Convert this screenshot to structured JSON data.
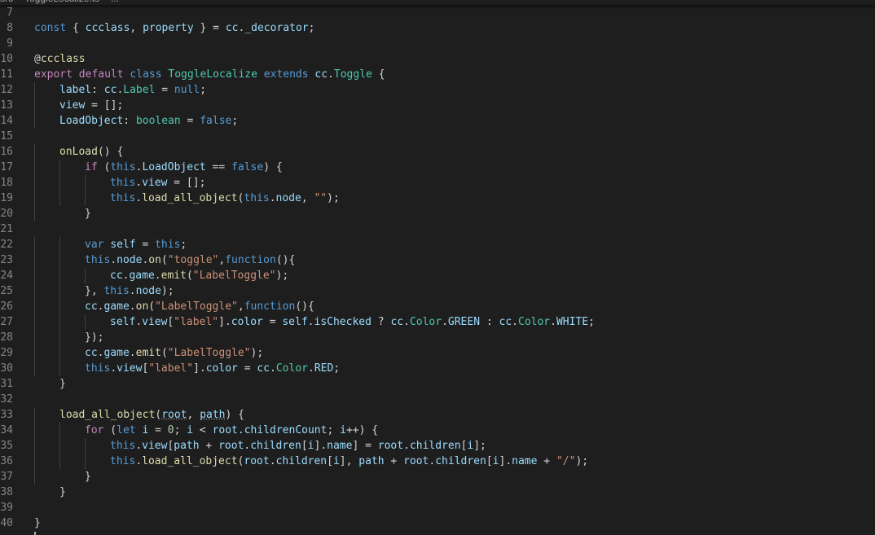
{
  "breadcrumb": {
    "items": [
      "src",
      "ToggleLocalize.ts",
      "..."
    ]
  },
  "editor": {
    "language": "typescript",
    "theme_colors": {
      "background": "#1e1e1e",
      "line_number": "#858585",
      "keyword": "#569cd6",
      "control_keyword": "#c586c0",
      "type": "#4ec9b0",
      "function": "#dcdcaa",
      "variable": "#9cdcfe",
      "string": "#ce9178",
      "number": "#b5cea8",
      "default_text": "#d4d4d4"
    },
    "lines": [
      {
        "num": "7",
        "indent": 0,
        "tokens": []
      },
      {
        "num": "8",
        "indent": 0,
        "tokens": [
          [
            "k",
            "const"
          ],
          [
            "p",
            " { "
          ],
          [
            "v",
            "ccclass"
          ],
          [
            "p",
            ", "
          ],
          [
            "v",
            "property"
          ],
          [
            "p",
            " } = "
          ],
          [
            "v",
            "cc"
          ],
          [
            "p",
            "."
          ],
          [
            "v",
            "_decorator"
          ],
          [
            "p",
            ";"
          ]
        ]
      },
      {
        "num": "9",
        "indent": 0,
        "tokens": []
      },
      {
        "num": "10",
        "indent": 0,
        "tokens": [
          [
            "p",
            "@"
          ],
          [
            "f",
            "ccclass"
          ]
        ]
      },
      {
        "num": "11",
        "indent": 0,
        "tokens": [
          [
            "c",
            "export"
          ],
          [
            "p",
            " "
          ],
          [
            "c",
            "default"
          ],
          [
            "p",
            " "
          ],
          [
            "k",
            "class"
          ],
          [
            "p",
            " "
          ],
          [
            "t",
            "ToggleLocalize"
          ],
          [
            "p",
            " "
          ],
          [
            "k",
            "extends"
          ],
          [
            "p",
            " "
          ],
          [
            "v",
            "cc"
          ],
          [
            "p",
            "."
          ],
          [
            "t",
            "Toggle"
          ],
          [
            "p",
            " {"
          ]
        ]
      },
      {
        "num": "12",
        "indent": 1,
        "tokens": [
          [
            "v",
            "label"
          ],
          [
            "p",
            ": "
          ],
          [
            "v",
            "cc"
          ],
          [
            "p",
            "."
          ],
          [
            "t",
            "Label"
          ],
          [
            "p",
            " = "
          ],
          [
            "k",
            "null"
          ],
          [
            "p",
            ";"
          ]
        ]
      },
      {
        "num": "13",
        "indent": 1,
        "tokens": [
          [
            "v",
            "view"
          ],
          [
            "p",
            " = [];"
          ]
        ]
      },
      {
        "num": "14",
        "indent": 1,
        "tokens": [
          [
            "v",
            "LoadObject"
          ],
          [
            "p",
            ": "
          ],
          [
            "t",
            "boolean"
          ],
          [
            "p",
            " = "
          ],
          [
            "k",
            "false"
          ],
          [
            "p",
            ";"
          ]
        ]
      },
      {
        "num": "15",
        "indent": 0,
        "tokens": []
      },
      {
        "num": "16",
        "indent": 1,
        "tokens": [
          [
            "f",
            "onLoad"
          ],
          [
            "p",
            "() {"
          ]
        ]
      },
      {
        "num": "17",
        "indent": 2,
        "tokens": [
          [
            "c",
            "if"
          ],
          [
            "p",
            " ("
          ],
          [
            "k",
            "this"
          ],
          [
            "p",
            "."
          ],
          [
            "v",
            "LoadObject"
          ],
          [
            "p",
            " == "
          ],
          [
            "k",
            "false"
          ],
          [
            "p",
            ") {"
          ]
        ]
      },
      {
        "num": "18",
        "indent": 3,
        "tokens": [
          [
            "k",
            "this"
          ],
          [
            "p",
            "."
          ],
          [
            "v",
            "view"
          ],
          [
            "p",
            " = [];"
          ]
        ]
      },
      {
        "num": "19",
        "indent": 3,
        "tokens": [
          [
            "k",
            "this"
          ],
          [
            "p",
            "."
          ],
          [
            "f",
            "load_all_object"
          ],
          [
            "p",
            "("
          ],
          [
            "k",
            "this"
          ],
          [
            "p",
            "."
          ],
          [
            "v",
            "node"
          ],
          [
            "p",
            ", "
          ],
          [
            "s",
            "\"\""
          ],
          [
            "p",
            ");"
          ]
        ]
      },
      {
        "num": "20",
        "indent": 2,
        "tokens": [
          [
            "p",
            "}"
          ]
        ]
      },
      {
        "num": "21",
        "indent": 0,
        "tokens": []
      },
      {
        "num": "22",
        "indent": 2,
        "tokens": [
          [
            "k",
            "var"
          ],
          [
            "p",
            " "
          ],
          [
            "v",
            "self"
          ],
          [
            "p",
            " = "
          ],
          [
            "k",
            "this"
          ],
          [
            "p",
            ";"
          ]
        ]
      },
      {
        "num": "23",
        "indent": 2,
        "tokens": [
          [
            "k",
            "this"
          ],
          [
            "p",
            "."
          ],
          [
            "v",
            "node"
          ],
          [
            "p",
            "."
          ],
          [
            "f",
            "on"
          ],
          [
            "p",
            "("
          ],
          [
            "s",
            "\"toggle\""
          ],
          [
            "p",
            ","
          ],
          [
            "k",
            "function"
          ],
          [
            "p",
            "(){"
          ]
        ]
      },
      {
        "num": "24",
        "indent": 3,
        "tokens": [
          [
            "v",
            "cc"
          ],
          [
            "p",
            "."
          ],
          [
            "v",
            "game"
          ],
          [
            "p",
            "."
          ],
          [
            "f",
            "emit"
          ],
          [
            "p",
            "("
          ],
          [
            "s",
            "\"LabelToggle\""
          ],
          [
            "p",
            ");"
          ]
        ]
      },
      {
        "num": "25",
        "indent": 2,
        "tokens": [
          [
            "p",
            "}, "
          ],
          [
            "k",
            "this"
          ],
          [
            "p",
            "."
          ],
          [
            "v",
            "node"
          ],
          [
            "p",
            ");"
          ]
        ]
      },
      {
        "num": "26",
        "indent": 2,
        "tokens": [
          [
            "v",
            "cc"
          ],
          [
            "p",
            "."
          ],
          [
            "v",
            "game"
          ],
          [
            "p",
            "."
          ],
          [
            "f",
            "on"
          ],
          [
            "p",
            "("
          ],
          [
            "s",
            "\"LabelToggle\""
          ],
          [
            "p",
            ","
          ],
          [
            "k",
            "function"
          ],
          [
            "p",
            "(){"
          ]
        ]
      },
      {
        "num": "27",
        "indent": 3,
        "tokens": [
          [
            "v",
            "self"
          ],
          [
            "p",
            "."
          ],
          [
            "v",
            "view"
          ],
          [
            "p",
            "["
          ],
          [
            "s",
            "\"label\""
          ],
          [
            "p",
            "]."
          ],
          [
            "v",
            "color"
          ],
          [
            "p",
            " = "
          ],
          [
            "v",
            "self"
          ],
          [
            "p",
            "."
          ],
          [
            "v",
            "isChecked"
          ],
          [
            "p",
            " ? "
          ],
          [
            "v",
            "cc"
          ],
          [
            "p",
            "."
          ],
          [
            "t",
            "Color"
          ],
          [
            "p",
            "."
          ],
          [
            "v",
            "GREEN"
          ],
          [
            "p",
            " : "
          ],
          [
            "v",
            "cc"
          ],
          [
            "p",
            "."
          ],
          [
            "t",
            "Color"
          ],
          [
            "p",
            "."
          ],
          [
            "v",
            "WHITE"
          ],
          [
            "p",
            ";"
          ]
        ]
      },
      {
        "num": "28",
        "indent": 2,
        "tokens": [
          [
            "p",
            "});"
          ]
        ]
      },
      {
        "num": "29",
        "indent": 2,
        "tokens": [
          [
            "v",
            "cc"
          ],
          [
            "p",
            "."
          ],
          [
            "v",
            "game"
          ],
          [
            "p",
            "."
          ],
          [
            "f",
            "emit"
          ],
          [
            "p",
            "("
          ],
          [
            "s",
            "\"LabelToggle\""
          ],
          [
            "p",
            ");"
          ]
        ]
      },
      {
        "num": "30",
        "indent": 2,
        "tokens": [
          [
            "k",
            "this"
          ],
          [
            "p",
            "."
          ],
          [
            "v",
            "view"
          ],
          [
            "p",
            "["
          ],
          [
            "s",
            "\"label\""
          ],
          [
            "p",
            "]."
          ],
          [
            "v",
            "color"
          ],
          [
            "p",
            " = "
          ],
          [
            "v",
            "cc"
          ],
          [
            "p",
            "."
          ],
          [
            "t",
            "Color"
          ],
          [
            "p",
            "."
          ],
          [
            "v",
            "RED"
          ],
          [
            "p",
            ";"
          ]
        ]
      },
      {
        "num": "31",
        "indent": 1,
        "tokens": [
          [
            "p",
            "}"
          ]
        ]
      },
      {
        "num": "32",
        "indent": 0,
        "tokens": []
      },
      {
        "num": "33",
        "indent": 1,
        "tokens": [
          [
            "f",
            "load_all_object"
          ],
          [
            "p",
            "("
          ],
          [
            "v u",
            "root"
          ],
          [
            "p",
            ", "
          ],
          [
            "v u",
            "path"
          ],
          [
            "p",
            ") {"
          ]
        ]
      },
      {
        "num": "34",
        "indent": 2,
        "tokens": [
          [
            "c",
            "for"
          ],
          [
            "p",
            " ("
          ],
          [
            "k",
            "let"
          ],
          [
            "p",
            " "
          ],
          [
            "v",
            "i"
          ],
          [
            "p",
            " = "
          ],
          [
            "n",
            "0"
          ],
          [
            "p",
            "; "
          ],
          [
            "v",
            "i"
          ],
          [
            "p",
            " < "
          ],
          [
            "v",
            "root"
          ],
          [
            "p",
            "."
          ],
          [
            "v",
            "childrenCount"
          ],
          [
            "p",
            "; "
          ],
          [
            "v",
            "i"
          ],
          [
            "p",
            "++) {"
          ]
        ]
      },
      {
        "num": "35",
        "indent": 3,
        "tokens": [
          [
            "k",
            "this"
          ],
          [
            "p",
            "."
          ],
          [
            "v",
            "view"
          ],
          [
            "p",
            "["
          ],
          [
            "v",
            "path"
          ],
          [
            "p",
            " + "
          ],
          [
            "v",
            "root"
          ],
          [
            "p",
            "."
          ],
          [
            "v",
            "children"
          ],
          [
            "p",
            "["
          ],
          [
            "v",
            "i"
          ],
          [
            "p",
            "]."
          ],
          [
            "v",
            "name"
          ],
          [
            "p",
            "] = "
          ],
          [
            "v",
            "root"
          ],
          [
            "p",
            "."
          ],
          [
            "v",
            "children"
          ],
          [
            "p",
            "["
          ],
          [
            "v",
            "i"
          ],
          [
            "p",
            "];"
          ]
        ]
      },
      {
        "num": "36",
        "indent": 3,
        "tokens": [
          [
            "k",
            "this"
          ],
          [
            "p",
            "."
          ],
          [
            "f",
            "load_all_object"
          ],
          [
            "p",
            "("
          ],
          [
            "v",
            "root"
          ],
          [
            "p",
            "."
          ],
          [
            "v",
            "children"
          ],
          [
            "p",
            "["
          ],
          [
            "v",
            "i"
          ],
          [
            "p",
            "], "
          ],
          [
            "v",
            "path"
          ],
          [
            "p",
            " + "
          ],
          [
            "v",
            "root"
          ],
          [
            "p",
            "."
          ],
          [
            "v",
            "children"
          ],
          [
            "p",
            "["
          ],
          [
            "v",
            "i"
          ],
          [
            "p",
            "]."
          ],
          [
            "v",
            "name"
          ],
          [
            "p",
            " + "
          ],
          [
            "s",
            "\"/\""
          ],
          [
            "p",
            ");"
          ]
        ]
      },
      {
        "num": "37",
        "indent": 2,
        "tokens": [
          [
            "p",
            "}"
          ]
        ]
      },
      {
        "num": "38",
        "indent": 1,
        "tokens": [
          [
            "p",
            "}"
          ]
        ]
      },
      {
        "num": "39",
        "indent": 0,
        "tokens": []
      },
      {
        "num": "40",
        "indent": 0,
        "tokens": [
          [
            "p",
            "}"
          ]
        ]
      }
    ]
  }
}
